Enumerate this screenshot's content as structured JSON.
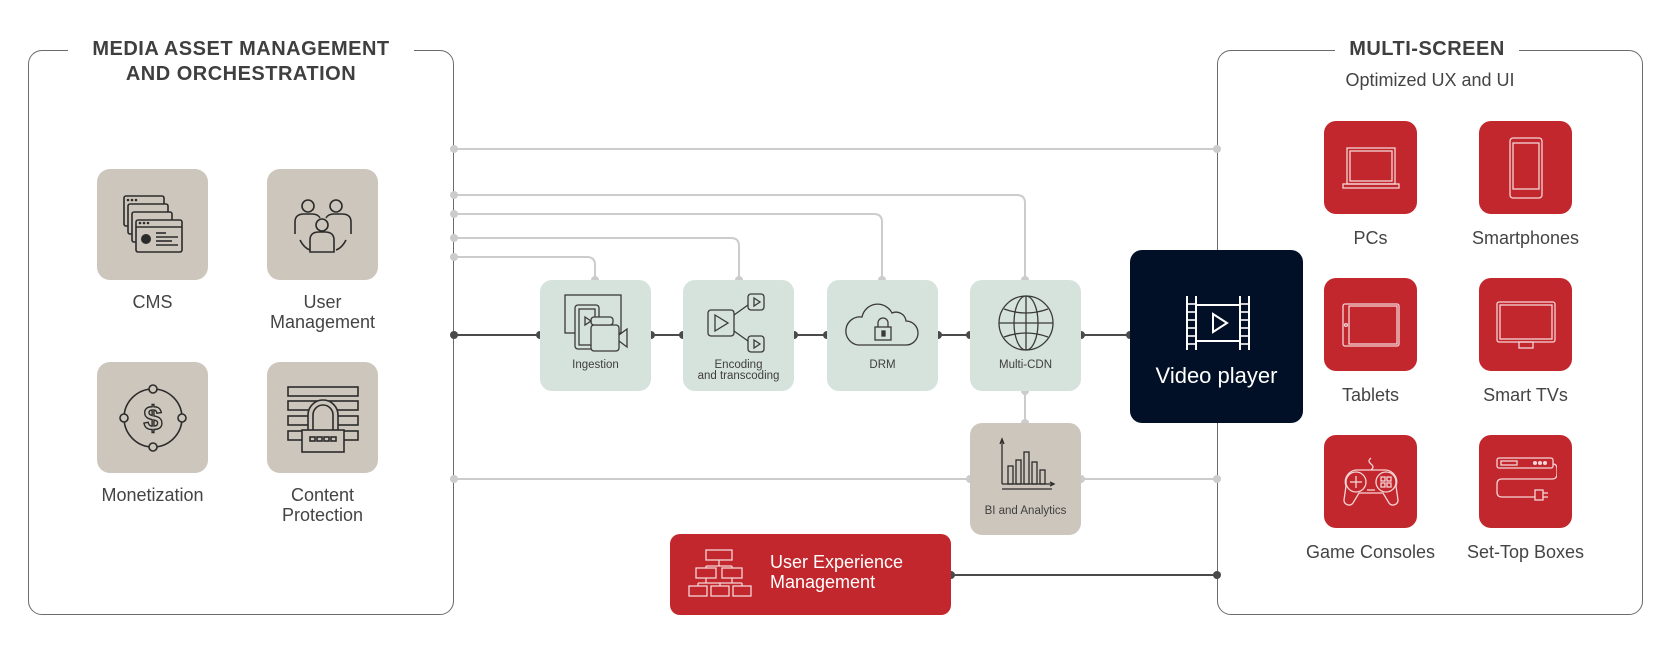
{
  "left_panel": {
    "title_line1": "MEDIA ASSET MANAGEMENT",
    "title_line2": "AND ORCHESTRATION",
    "items": [
      {
        "label_line1": "CMS",
        "label_line2": "",
        "icon": "cms-windows-gear-icon"
      },
      {
        "label_line1": "User",
        "label_line2": "Management",
        "icon": "users-group-icon"
      },
      {
        "label_line1": "Monetization",
        "label_line2": "",
        "icon": "dollar-circle-icon"
      },
      {
        "label_line1": "Content",
        "label_line2": "Protection",
        "icon": "padlock-layers-icon"
      }
    ]
  },
  "pipeline": {
    "stages": [
      {
        "label_line1": "Ingestion",
        "label_line2": "",
        "icon": "camera-ingest-icon"
      },
      {
        "label_line1": "Encoding",
        "label_line2": "and transcoding",
        "icon": "play-split-icon"
      },
      {
        "label_line1": "DRM",
        "label_line2": "",
        "icon": "cloud-lock-icon"
      },
      {
        "label_line1": "Multi-CDN",
        "label_line2": "",
        "icon": "globe-icon"
      }
    ],
    "analytics": {
      "label": "BI and Analytics",
      "icon": "bar-chart-icon"
    },
    "player": {
      "label": "Video player",
      "icon": "film-play-icon"
    },
    "ux_management": {
      "label_line1": "User Experience",
      "label_line2": "Management",
      "icon": "hierarchy-icon"
    }
  },
  "right_panel": {
    "title": "MULTI-SCREEN",
    "subtitle": "Optimized UX and UI",
    "devices": [
      {
        "label": "PCs",
        "icon": "laptop-icon"
      },
      {
        "label": "Smartphones",
        "icon": "smartphone-icon"
      },
      {
        "label": "Tablets",
        "icon": "tablet-icon"
      },
      {
        "label": "Smart TVs",
        "icon": "tv-icon"
      },
      {
        "label": "Game Consoles",
        "icon": "gamepad-icon"
      },
      {
        "label": "Set-Top Boxes",
        "icon": "set-top-box-icon"
      }
    ]
  },
  "colors": {
    "accent_red": "#c1272d",
    "player_navy": "#021027",
    "stage_green": "#d6e2dc",
    "tile_beige": "#cdc6bc",
    "wire_light": "#cccccc",
    "wire_dark": "#4a4a4a"
  }
}
